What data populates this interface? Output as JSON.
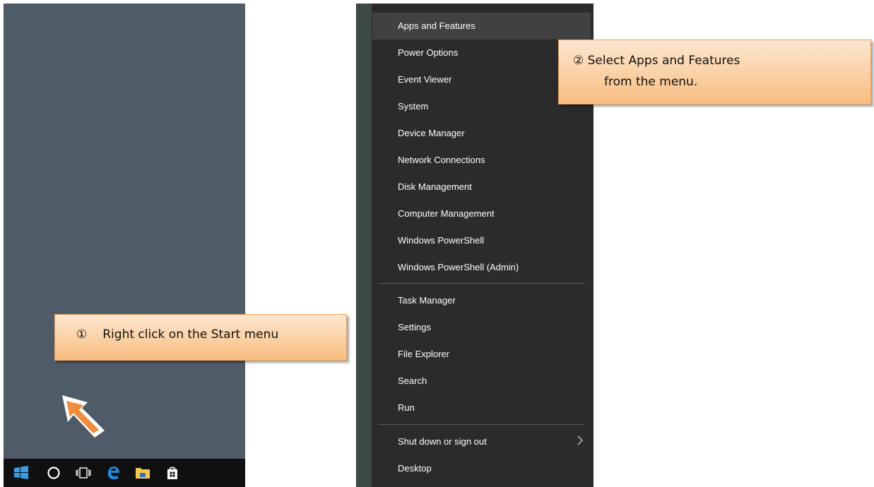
{
  "callouts": {
    "step1_number": "①",
    "step1_text": "Right click on the Start menu",
    "step2_line1": "② Select Apps and Features",
    "step2_line2": "from the menu."
  },
  "taskbar": {
    "icons": [
      "windows-start-icon",
      "cortana-circle-icon",
      "task-view-icon",
      "edge-icon",
      "file-explorer-icon",
      "store-icon"
    ]
  },
  "menu": {
    "items": [
      "Apps and Features",
      "Power Options",
      "Event Viewer",
      "System",
      "Device Manager",
      "Network Connections",
      "Disk Management",
      "Computer Management",
      "Windows PowerShell",
      "Windows PowerShell (Admin)",
      "Task Manager",
      "Settings",
      "File Explorer",
      "Search",
      "Run",
      "Shut down or sign out",
      "Desktop"
    ],
    "highlighted": "Apps and Features"
  },
  "colors": {
    "desktop": "#4f5b67",
    "taskbar": "#101010",
    "menu_bg": "#2b2b2b",
    "menu_highlight": "#414141",
    "callout_fill": "#f8bd80",
    "arrow": "#f08c3c",
    "windows_blue": "#3b9be6"
  }
}
